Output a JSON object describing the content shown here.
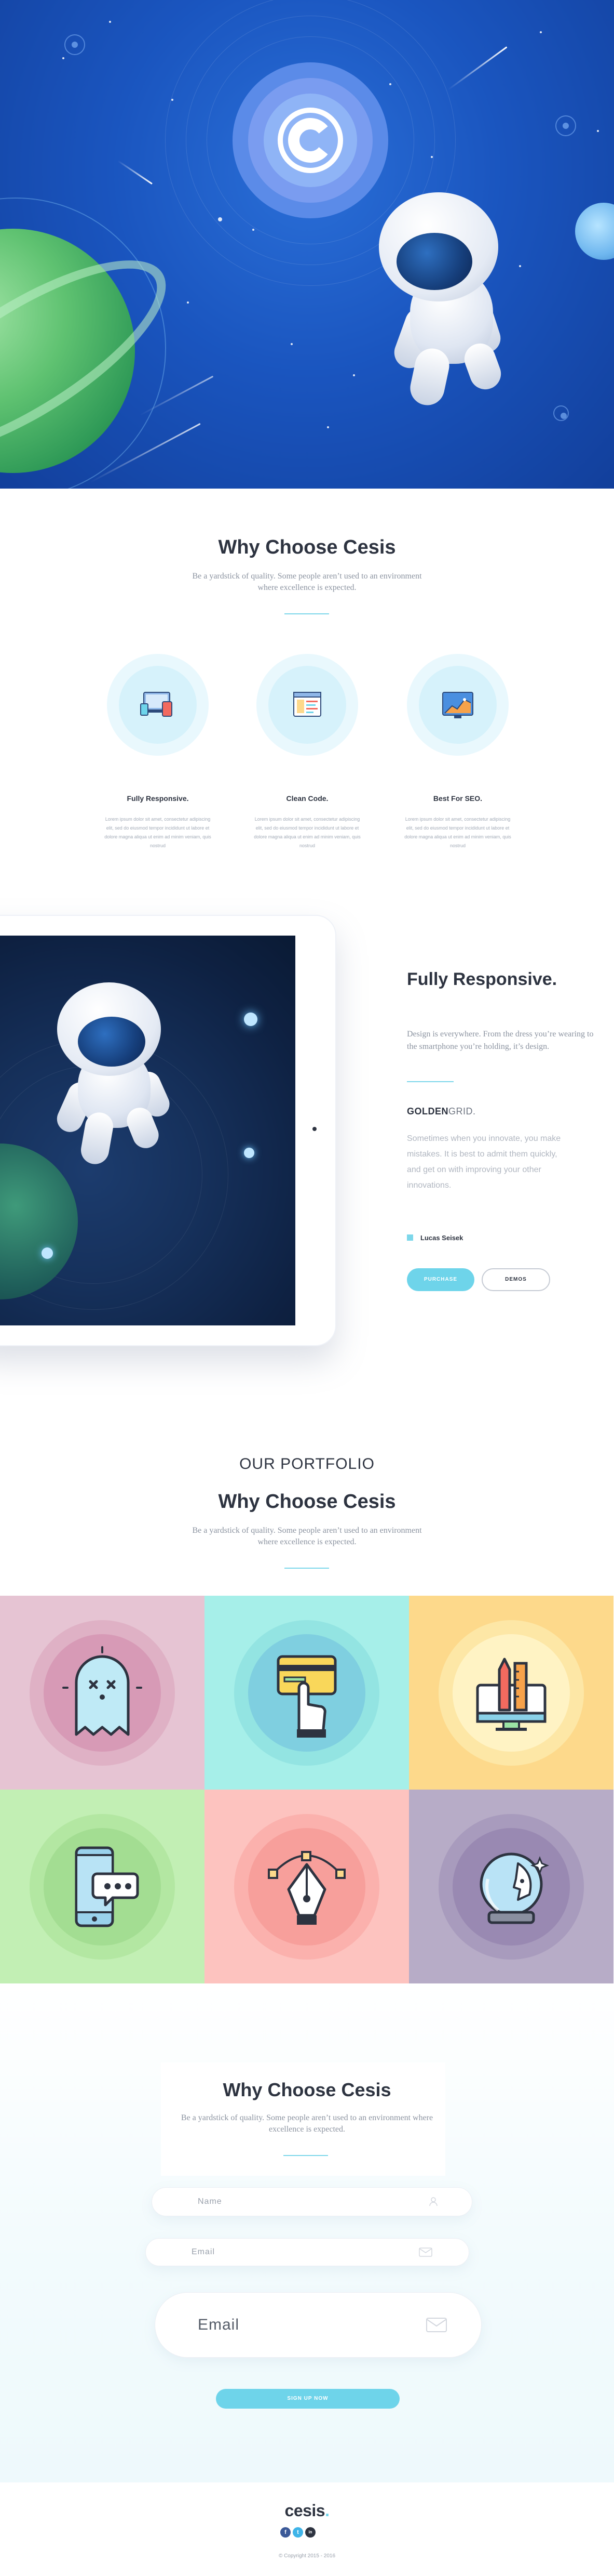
{
  "hero": {
    "logo_alt": "Cesis logo"
  },
  "why": {
    "title": "Why Choose Cesis",
    "subtitle": "Be a yardstick of quality. Some people aren’t used to an environment where excellence is expected.",
    "features": [
      {
        "title": "Fully Responsive.",
        "text": "Lorem ipsum dolor sit amet, consectetur adipiscing elit, sed do eiusmod tempor incididunt ut labore et dolore magna aliqua ut enim ad minim veniam, quis nostrud"
      },
      {
        "title": "Clean Code.",
        "text": "Lorem ipsum dolor sit amet, consectetur adipiscing elit, sed do eiusmod tempor incididunt ut labore et dolore magna aliqua ut enim ad minim veniam, quis nostrud"
      },
      {
        "title": "Best For SEO.",
        "text": "Lorem ipsum dolor sit amet, consectetur adipiscing elit, sed do eiusmod tempor incididunt ut labore et dolore magna aliqua ut enim ad minim veniam, quis nostrud"
      }
    ]
  },
  "responsive": {
    "title": "Fully Responsive.",
    "description": "Design is everywhere. From the dress you’re wearing to the smartphone you’re holding, it’s design.",
    "brand_bold": "GOLDEN",
    "brand_light": "GRID.",
    "quote": "Sometimes when you innovate, you make mistakes. It is best to admit them quickly, and get on with improving your other innovations.",
    "author": "Lucas Seisek",
    "primary_button": "PURCHASE",
    "secondary_button": "DEMOS"
  },
  "portfolio": {
    "kicker": "OUR PORTFOLIO",
    "title": "Why Choose Cesis",
    "subtitle": "Be a yardstick of quality. Some people aren’t used to an environment where excellence is expected.",
    "tiles": [
      {
        "icon": "ghost-icon",
        "bg": "#e6c4d3"
      },
      {
        "icon": "card-payment-icon",
        "bg": "#a6efe9"
      },
      {
        "icon": "design-monitor-icon",
        "bg": "#fdd98b"
      },
      {
        "icon": "phone-chat-icon",
        "bg": "#c2efb4"
      },
      {
        "icon": "pen-tool-icon",
        "bg": "#fdc3bf"
      },
      {
        "icon": "space-helmet-icon",
        "bg": "#b7acc7"
      }
    ]
  },
  "signup": {
    "title": "Why Choose Cesis",
    "subtitle": "Be a yardstick of quality. Some people aren’t used to an environment where excellence is expected.",
    "name_placeholder": "Name",
    "email_placeholder": "Email",
    "email_big_placeholder": "Email",
    "button": "SIGN UP NOW"
  },
  "footer": {
    "logo": "cesis",
    "logo_dot": ".",
    "social": [
      "f",
      "t",
      "in"
    ],
    "copyright": "© Copyright 2015 - 2016"
  },
  "colors": {
    "accent": "#6ed4ea",
    "hero_blue": "#1a55bf",
    "text_dark": "#2d3340"
  }
}
